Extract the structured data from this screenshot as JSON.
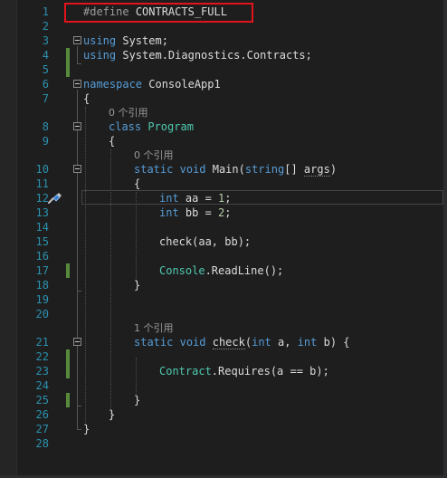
{
  "editor": {
    "line_numbers": [
      "1",
      "2",
      "3",
      "4",
      "5",
      "6",
      "7",
      "8",
      "9",
      "10",
      "11",
      "12",
      "13",
      "14",
      "15",
      "16",
      "17",
      "18",
      "19",
      "20",
      "21",
      "22",
      "23",
      "24",
      "25",
      "26",
      "27",
      "28"
    ],
    "lines": {
      "l1_define": "#define",
      "l1_symbol": "CONTRACTS_FULL",
      "l3_using": "using",
      "l3_ns": " System;",
      "l4_using": "using",
      "l4_ns": " System.Diagnostics.Contracts;",
      "l6_kw": "namespace",
      "l6_name": " ConsoleApp1",
      "l7": "{",
      "l8_kw": "class",
      "l8_sp": " ",
      "l8_name": "Program",
      "l9": "{",
      "l10_static": "static",
      "l10_sp1": " ",
      "l10_void": "void",
      "l10_main": " Main(",
      "l10_string": "string",
      "l10_bracket": "[] ",
      "l10_args": "args",
      "l10_close": ")",
      "l11": "{",
      "l12_int": "int",
      "l12_rest": " aa = ",
      "l12_num": "1",
      "l12_end": ";",
      "l13_int": "int",
      "l13_rest": " bb = ",
      "l13_num": "2",
      "l13_end": ";",
      "l15": "check(aa, bb);",
      "l17_class": "Console",
      "l17_rest": ".ReadLine();",
      "l18": "}",
      "l21_static": "static",
      "l21_sp1": " ",
      "l21_void": "void",
      "l21_sp2": " ",
      "l21_check": "check",
      "l21_p1": "(",
      "l21_int1": "int",
      "l21_p2": " a, ",
      "l21_int2": "int",
      "l21_p3": " b) {",
      "l23_class": "Contract",
      "l23_rest": ".Requires(a == b);",
      "l25": "}",
      "l26": "}",
      "l27": "}"
    },
    "codelens": {
      "program_refs": "0 个引用",
      "main_refs": "0 个引用",
      "check_refs": "1 个引用"
    },
    "icons": {
      "quick_actions": "paintbrush-icon",
      "fold": "collapse-icon"
    },
    "colors": {
      "keyword": "#569cd6",
      "type": "#4ec9b0",
      "line_number": "#2b91af",
      "highlight_box": "#e3131b",
      "change_bar": "#578a3b"
    }
  }
}
